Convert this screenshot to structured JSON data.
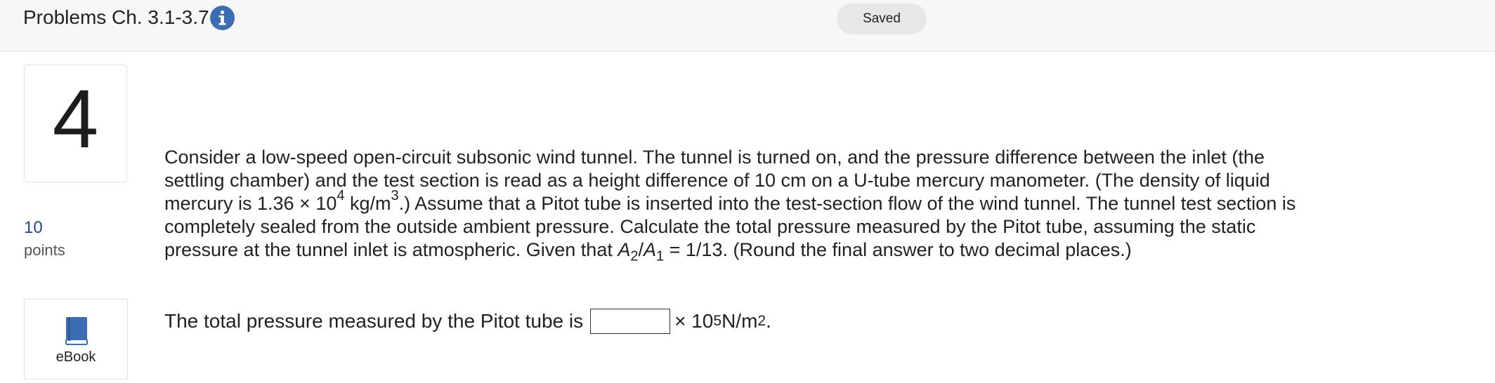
{
  "header": {
    "title": "Problems Ch. 3.1-3.7",
    "info_icon": "info-icon",
    "saved_label": "Saved"
  },
  "question": {
    "number": "4",
    "points_value": "10",
    "points_label": "points",
    "ebook_label": "eBook",
    "lines": {
      "l1": "Consider a low-speed open-circuit subsonic wind tunnel. The tunnel is turned on, and the pressure difference between the inlet (the",
      "l2": "settling chamber) and the test section is read as a height difference of 10 cm on a U-tube mercury manometer. (The density of liquid",
      "l3_a": "mercury is 1.36 × 10",
      "l3_sup1": "4",
      "l3_b": " kg/m",
      "l3_sup2": "3",
      "l3_c": ".) Assume that a Pitot tube is inserted into the test-section flow of the wind tunnel. The tunnel test section is",
      "l4": "completely sealed from the outside ambient pressure. Calculate the total pressure measured by the Pitot tube, assuming the static",
      "l5_a": "pressure at the tunnel inlet is atmospheric. Given that ",
      "l5_A2": "A",
      "l5_sub2": "2",
      "l5_slash": "/",
      "l5_A1": "A",
      "l5_sub1": "1",
      "l5_b": " = 1/13. (Round the final answer to two decimal places.)"
    },
    "answer": {
      "prefix": "The total pressure measured by the Pitot tube is",
      "value": "",
      "times": "× 10",
      "exponent": "5",
      "unit": " N/m",
      "unit_exp": "2",
      "end": "."
    }
  },
  "colors": {
    "accent": "#3b6db3",
    "points": "#1f4a8a",
    "topbar": "#f7f7f7"
  }
}
